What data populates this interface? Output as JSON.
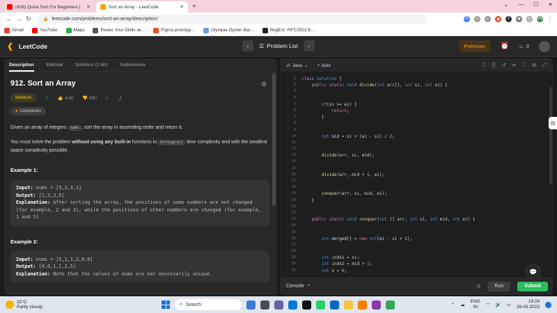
{
  "browser": {
    "tabs": [
      {
        "title": "(438) Quick Sort For Beginners |",
        "active": false,
        "favicon_color": "#ff0000"
      },
      {
        "title": "Sort an Array - LeetCode",
        "active": true,
        "favicon_color": "#ffa116"
      }
    ],
    "new_tab": "+",
    "url": "leetcode.com/problems/sort-an-array/description/",
    "bookmarks": [
      "Gmail",
      "YouTube",
      "Maps",
      "Power Your Skills wi...",
      "Figma prototyp...",
      "Olympia Oyster Bar...",
      "RegExr: RFC2822 E..."
    ],
    "profile_initials": "MV"
  },
  "nav": {
    "logo": "LeetCode",
    "problem_list": "Problem List",
    "premium": "Premium",
    "streak": "0"
  },
  "left": {
    "tabs": [
      "Description",
      "Editorial",
      "Solutions (2.9K)",
      "Submissions"
    ],
    "title": "912. Sort an Array",
    "difficulty": "Medium",
    "likes": "4.5K",
    "dislikes": "690",
    "companies": "Companies",
    "desc1_pre": "Given an array of integers ",
    "desc1_code": "nums",
    "desc1_post": ", sort the array in ascending order and return it.",
    "desc2_pre": "You must solve the problem ",
    "desc2_bold": "without using any built-in",
    "desc2_mid": " functions in ",
    "desc2_code": "O(nlog(n))",
    "desc2_post": " time complexity and with the smallest space complexity possible.",
    "example1": {
      "heading": "Example 1:",
      "input_label": "Input:",
      "input": " nums = [5,2,3,1]",
      "output_label": "Output:",
      "output": " [1,2,3,5]",
      "expl_label": "Explanation:",
      "expl": " After sorting the array, the positions of some numbers are not changed (for example, 2 and 3), while the positions of other numbers are changed (for example, 1 and 5)."
    },
    "example2": {
      "heading": "Example 2:",
      "input_label": "Input:",
      "input": " nums = [5,1,1,2,0,0]",
      "output_label": "Output:",
      "output": " [0,0,1,1,2,5]",
      "expl_label": "Explanation:",
      "expl": " Note that the values of nums are not necessarily unique."
    }
  },
  "editor": {
    "language": "Java",
    "autosave": "Auto",
    "line_numbers": [
      "1",
      "2",
      "3",
      "4",
      "5",
      "6",
      "7",
      "8",
      "9",
      "10",
      "11",
      "12",
      "13",
      "14",
      "15",
      "16",
      "17",
      "18",
      "19",
      "20",
      "21",
      "22",
      "23",
      "24",
      "25",
      "26",
      "27",
      "28",
      "29",
      "30",
      "31"
    ],
    "console": "Console",
    "run": "Run",
    "submit": "Submit"
  },
  "taskbar": {
    "temp": "32°C",
    "weather": "Partly cloudy",
    "search": "Search",
    "lang1": "ENG",
    "lang2": "IN",
    "time": "19:24",
    "date": "29-05-2023"
  },
  "colors": {
    "accent": "#ffa116",
    "submit": "#2cbb5d",
    "medium": "#ffc01e"
  }
}
